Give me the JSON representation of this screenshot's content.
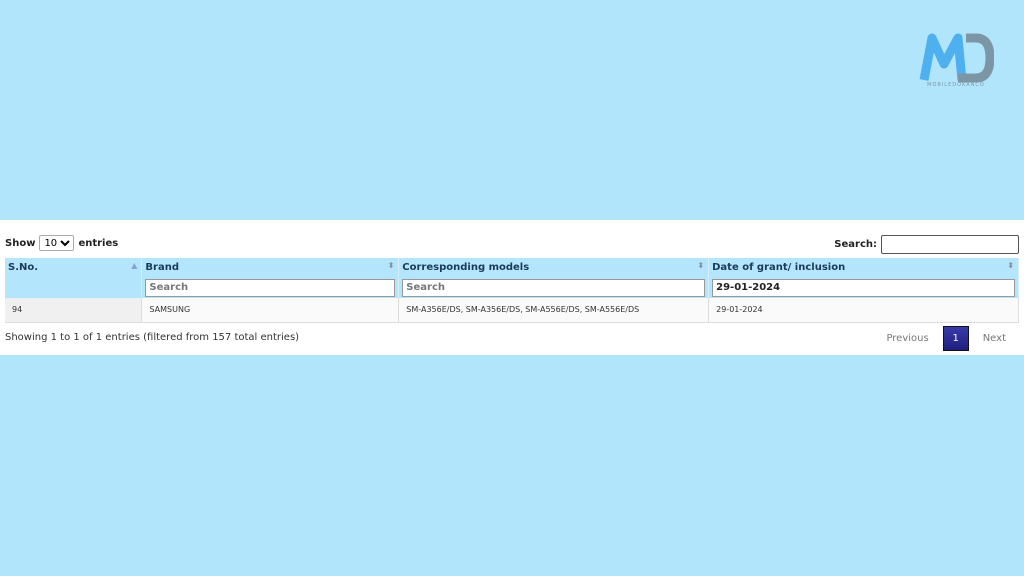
{
  "logo": {
    "letters": "MD",
    "text": "MOBILEDOKANCO"
  },
  "length": {
    "show": "Show",
    "value": "10",
    "entries": "entries"
  },
  "search": {
    "label": "Search:",
    "value": ""
  },
  "table": {
    "columns": [
      "S.No.",
      "Brand",
      "Corresponding models",
      "Date of grant/ inclusion"
    ],
    "filters": {
      "brand_placeholder": "Search",
      "models_placeholder": "Search",
      "date_value": "29-01-2024"
    },
    "rows": [
      [
        "94",
        "SAMSUNG",
        "SM-A356E/DS, SM-A356E/DS, SM-A556E/DS, SM-A556E/DS",
        "29-01-2024"
      ]
    ]
  },
  "info": "Showing 1 to 1 of 1 entries (filtered from 157 total entries)",
  "pagination": {
    "previous": "Previous",
    "current": "1",
    "next": "Next"
  }
}
